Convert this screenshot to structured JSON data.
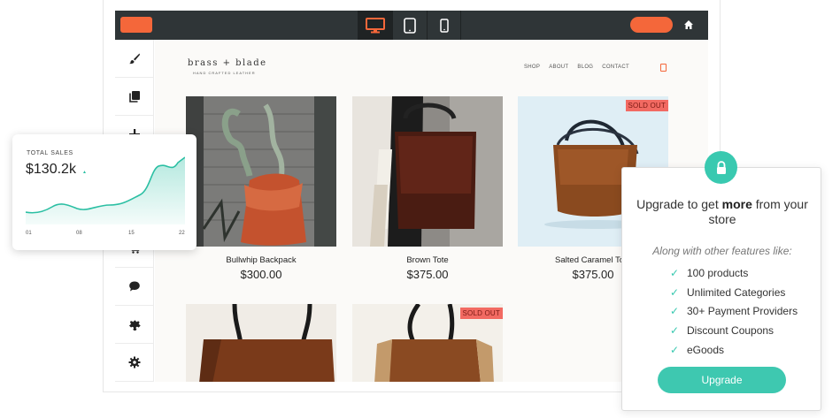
{
  "toolbar": {
    "devices": [
      "desktop",
      "tablet",
      "mobile"
    ],
    "active_device": "desktop",
    "icons": {
      "desktop": "desktop-icon",
      "tablet": "tablet-icon",
      "mobile": "mobile-icon",
      "home": "home-icon"
    },
    "accent_color": "#f4673a",
    "bar_color": "#2f3537"
  },
  "sidebar": {
    "items": [
      "brush-icon",
      "pages-icon",
      "add-icon",
      "cart-icon",
      "chat-icon",
      "puzzle-icon",
      "gear-icon"
    ]
  },
  "store": {
    "brand": "brass + blade",
    "tagline": "HAND CRAFTED LEATHER",
    "nav": [
      "SHOP",
      "ABOUT",
      "BLOG",
      "CONTACT"
    ],
    "sold_out_label": "SOLD OUT",
    "products": [
      {
        "name": "Bullwhip Backpack",
        "price": "$300.00",
        "sold_out": false
      },
      {
        "name": "Brown Tote",
        "price": "$375.00",
        "sold_out": false
      },
      {
        "name": "Salted Caramel Tote",
        "price": "$375.00",
        "sold_out": true
      },
      {
        "name": "",
        "price": "",
        "sold_out": false
      },
      {
        "name": "",
        "price": "",
        "sold_out": true
      }
    ]
  },
  "sales": {
    "label": "TOTAL SALES",
    "value": "$130.2k",
    "trend": "▲",
    "ticks": [
      "01",
      "08",
      "15",
      "22"
    ],
    "line_color": "#2bbfa3"
  },
  "upgrade": {
    "title_prefix": "Upgrade to get ",
    "title_bold": "more",
    "title_suffix": " from your store",
    "subtitle": "Along with other features like:",
    "features": [
      "100 products",
      "Unlimited Categories",
      "30+ Payment Providers",
      "Discount Coupons",
      "eGoods"
    ],
    "button_label": "Upgrade",
    "accent_color": "#3ec8b0"
  }
}
